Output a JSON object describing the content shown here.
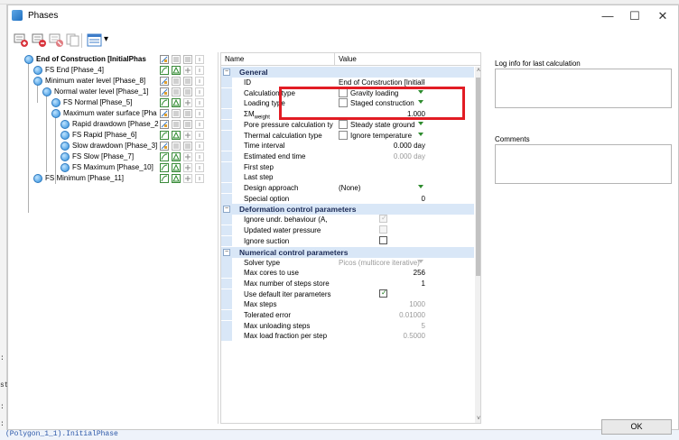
{
  "window": {
    "title": "Phases",
    "controls": {
      "minimize": "—",
      "maximize": "☐",
      "close": "✕"
    }
  },
  "toolbar": {
    "icons": [
      "add-phase-icon",
      "insert-phase-icon",
      "delete-phase-icon",
      "copy-phase-icon",
      "view-menu-icon"
    ],
    "dropdown_arrow": "▾"
  },
  "tree": [
    {
      "label": "End of Construction [InitialPhas",
      "level": 0,
      "bold": true,
      "icons": [
        "flow",
        "calc",
        "calc",
        "info"
      ]
    },
    {
      "label": "FS End [Phase_4]",
      "level": 1,
      "icons": [
        "curve",
        "tri",
        "plus",
        "info"
      ]
    },
    {
      "label": "Minimum water level [Phase_8]",
      "level": 1,
      "icons": [
        "flow",
        "calc",
        "calc",
        "info"
      ]
    },
    {
      "label": "Normal water level [Phase_1]",
      "level": 2,
      "icons": [
        "flow",
        "calc",
        "calc",
        "info"
      ]
    },
    {
      "label": "FS Normal [Phase_5]",
      "level": 3,
      "icons": [
        "curve",
        "tri",
        "plus",
        "info"
      ]
    },
    {
      "label": "Maximum water surface [Pha",
      "level": 3,
      "icons": [
        "flow",
        "calc",
        "calc",
        "info"
      ]
    },
    {
      "label": "Rapid drawdown [Phase_2",
      "level": 4,
      "icons": [
        "flow",
        "calc",
        "calc",
        "info"
      ]
    },
    {
      "label": "FS Rapid [Phase_6]",
      "level": 4,
      "icons": [
        "curve",
        "tri",
        "plus",
        "info"
      ]
    },
    {
      "label": "Slow drawdown [Phase_3]",
      "level": 4,
      "icons": [
        "flow",
        "calc",
        "calc",
        "info"
      ]
    },
    {
      "label": "FS Slow [Phase_7]",
      "level": 4,
      "icons": [
        "curve",
        "tri",
        "plus",
        "info"
      ]
    },
    {
      "label": "FS Maximum [Phase_10]",
      "level": 4,
      "icons": [
        "curve",
        "tri",
        "plus",
        "info"
      ]
    },
    {
      "label": "FS Minimum [Phase_11]",
      "level": 1,
      "icons": [
        "curve",
        "tri",
        "plus",
        "info"
      ]
    }
  ],
  "grid": {
    "header": {
      "name": "Name",
      "value": "Value"
    },
    "sections": [
      {
        "title": "General",
        "toggle": "⊟",
        "rows": [
          {
            "name": "ID",
            "value": "End of Construction [InitialPl",
            "kind": "text"
          },
          {
            "name": "Calculation type",
            "value": "Gravity loading",
            "kind": "drop",
            "icon": "gravity-icon"
          },
          {
            "name": "Loading type",
            "value": "Staged construction",
            "kind": "drop",
            "icon": "staged-icon"
          },
          {
            "name": "ΣM",
            "sub": "weight",
            "value": "1.000",
            "kind": "num"
          },
          {
            "name": "Pore pressure calculation ty",
            "value": "Steady state ground",
            "kind": "drop",
            "icon": "pore-icon"
          },
          {
            "name": "Thermal calculation type",
            "value": "Ignore temperature",
            "kind": "drop",
            "icon": "thermal-icon"
          },
          {
            "name": "Time interval",
            "value": "0.000 day",
            "kind": "num"
          },
          {
            "name": "Estimated end time",
            "value": "0.000 day",
            "kind": "num",
            "dim": true
          },
          {
            "name": "First step",
            "value": "",
            "kind": "text"
          },
          {
            "name": "Last step",
            "value": "",
            "kind": "text"
          },
          {
            "name": "Design approach",
            "value": "(None)",
            "kind": "drop"
          },
          {
            "name": "Special option",
            "value": "0",
            "kind": "num"
          }
        ]
      },
      {
        "title": "Deformation control parameters",
        "toggle": "⊟",
        "rows": [
          {
            "name": "Ignore undr. behaviour (A,",
            "value": "✓",
            "kind": "chk",
            "disabled": true
          },
          {
            "name": "Updated water pressure",
            "value": "",
            "kind": "chk",
            "disabled": true
          },
          {
            "name": "Ignore suction",
            "value": "",
            "kind": "chk"
          }
        ]
      },
      {
        "title": "Numerical control parameters",
        "toggle": "⊟",
        "rows": [
          {
            "name": "Solver type",
            "value": "Picos (multicore iterative)",
            "kind": "drop",
            "dim": true
          },
          {
            "name": "Max cores to use",
            "value": "256",
            "kind": "num"
          },
          {
            "name": "Max number of steps store",
            "value": "1",
            "kind": "num"
          },
          {
            "name": "Use default iter parameters",
            "value": "✓",
            "kind": "chk"
          },
          {
            "name": "Max steps",
            "value": "1000",
            "kind": "num",
            "dim": true
          },
          {
            "name": "Tolerated error",
            "value": "0.01000",
            "kind": "num",
            "dim": true
          },
          {
            "name": "Max unloading steps",
            "value": "5",
            "kind": "num",
            "dim": true
          },
          {
            "name": "Max load fraction per step",
            "value": "0.5000",
            "kind": "num",
            "dim": true
          }
        ]
      }
    ],
    "scroll": {
      "up": "˄",
      "down": "˅"
    }
  },
  "right_panel": {
    "log_label": "Log info for last calculation",
    "comments_label": "Comments"
  },
  "ok_button": "OK",
  "background": {
    "left_fragments": [
      ":",
      "stor",
      ": (",
      ": ("
    ],
    "status_text": "(Polygon_1_1).InitialPhase"
  },
  "colors": {
    "highlight": "#e21c24",
    "section_bg": "#d9e7f7",
    "section_text": "#1b2a56",
    "phase_dot": "#2f8fdc"
  }
}
